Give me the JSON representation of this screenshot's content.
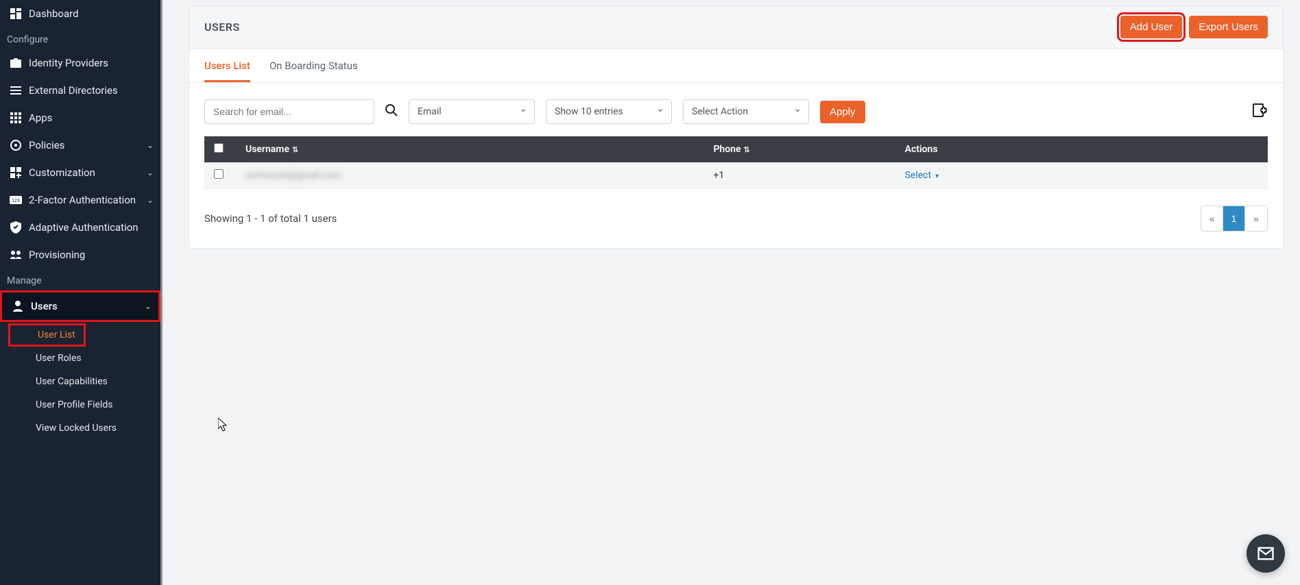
{
  "sidebar": {
    "top_items": [
      {
        "icon": "dashboard",
        "label": "Dashboard"
      }
    ],
    "sections": [
      {
        "header": "Configure",
        "items": [
          {
            "icon": "id-card",
            "label": "Identity Providers"
          },
          {
            "icon": "directory",
            "label": "External Directories"
          },
          {
            "icon": "apps",
            "label": "Apps"
          },
          {
            "icon": "policy",
            "label": "Policies",
            "expandable": true
          },
          {
            "icon": "customize",
            "label": "Customization",
            "expandable": true
          },
          {
            "icon": "2fa",
            "label": "2-Factor Authentication",
            "expandable": true
          },
          {
            "icon": "shield-check",
            "label": "Adaptive Authentication"
          },
          {
            "icon": "provisioning",
            "label": "Provisioning"
          }
        ]
      },
      {
        "header": "Manage",
        "items": [
          {
            "icon": "user",
            "label": "Users",
            "expandable": true,
            "active": true,
            "children": [
              {
                "label": "User List",
                "active": true
              },
              {
                "label": "User Roles"
              },
              {
                "label": "User Capabilities"
              },
              {
                "label": "User Profile Fields"
              },
              {
                "label": "View Locked Users"
              }
            ]
          }
        ]
      }
    ]
  },
  "header": {
    "title": "USERS",
    "add_user_btn": "Add User",
    "export_btn": "Export Users"
  },
  "tabs": [
    {
      "label": "Users List",
      "active": true
    },
    {
      "label": "On Boarding Status"
    }
  ],
  "filters": {
    "search_placeholder": "Search for email...",
    "by_field": "Email",
    "page_size": "Show 10 entries",
    "action": "Select Action",
    "apply_btn": "Apply"
  },
  "table": {
    "columns": [
      "",
      "Username",
      "Phone",
      "Actions"
    ],
    "rows": [
      {
        "username": "someuser@gmail.com",
        "phone": "+1",
        "action_label": "Select"
      }
    ]
  },
  "footer": {
    "showing": "Showing 1 - 1 of total 1 users",
    "prev": "«",
    "page": "1",
    "next": "»"
  }
}
